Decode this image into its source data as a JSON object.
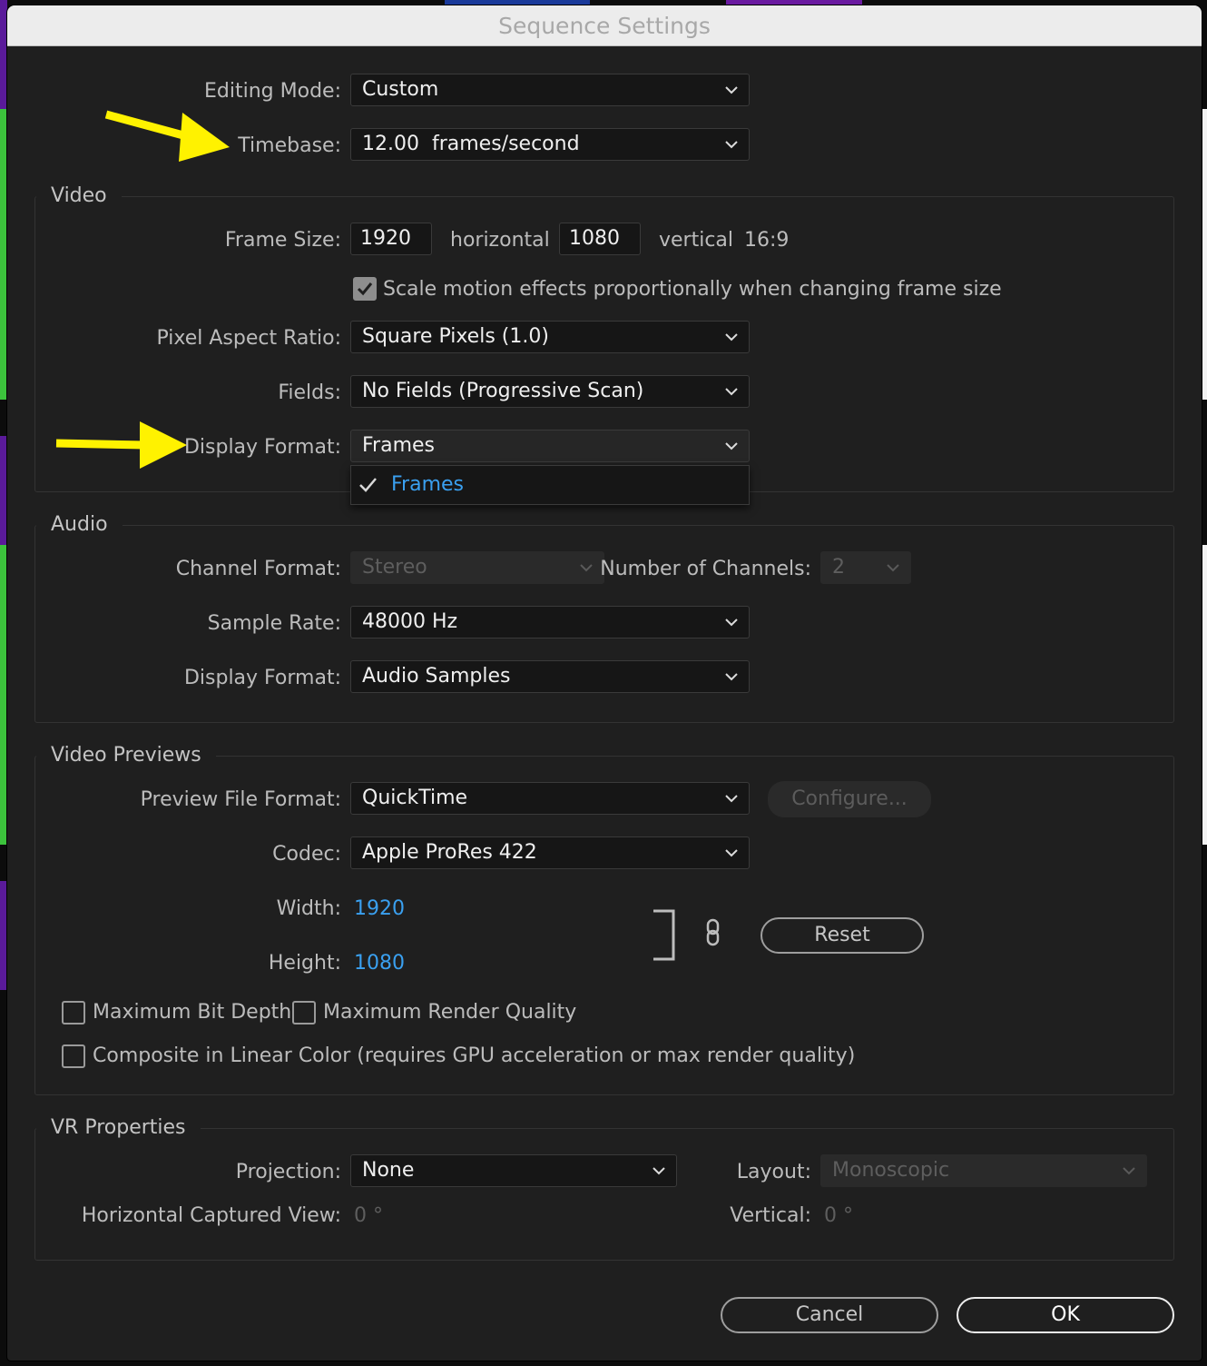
{
  "window": {
    "title": "Sequence Settings"
  },
  "general": {
    "editing_mode": {
      "label": "Editing Mode:",
      "value": "Custom"
    },
    "timebase": {
      "label": "Timebase:",
      "value": "12.00  frames/second"
    }
  },
  "video": {
    "title": "Video",
    "frame_size": {
      "label": "Frame Size:",
      "horizontal": "1920",
      "horizontal_label": "horizontal",
      "vertical": "1080",
      "vertical_label": "vertical",
      "aspect": "16:9"
    },
    "scale_motion": {
      "label": "Scale motion effects proportionally when changing frame size",
      "checked": true
    },
    "pixel_aspect": {
      "label": "Pixel Aspect Ratio:",
      "value": "Square Pixels (1.0)"
    },
    "fields": {
      "label": "Fields:",
      "value": "No Fields (Progressive Scan)"
    },
    "display_format": {
      "label": "Display Format:",
      "value": "Frames",
      "menu_options": [
        "Frames"
      ],
      "menu_selected": "Frames"
    }
  },
  "audio": {
    "title": "Audio",
    "channel_format": {
      "label": "Channel Format:",
      "value": "Stereo"
    },
    "num_channels": {
      "label": "Number of Channels:",
      "value": "2"
    },
    "sample_rate": {
      "label": "Sample Rate:",
      "value": "48000 Hz"
    },
    "display_format": {
      "label": "Display Format:",
      "value": "Audio Samples"
    }
  },
  "previews": {
    "title": "Video Previews",
    "file_format": {
      "label": "Preview File Format:",
      "value": "QuickTime"
    },
    "configure_button": "Configure...",
    "codec": {
      "label": "Codec:",
      "value": "Apple ProRes 422"
    },
    "width": {
      "label": "Width:",
      "value": "1920"
    },
    "height": {
      "label": "Height:",
      "value": "1080"
    },
    "reset_button": "Reset",
    "max_bit_depth": {
      "label": "Maximum Bit Depth",
      "checked": false
    },
    "max_render_quality": {
      "label": "Maximum Render Quality",
      "checked": false
    },
    "composite_linear": {
      "label": "Composite in Linear Color (requires GPU acceleration or max render quality)",
      "checked": false
    }
  },
  "vr": {
    "title": "VR Properties",
    "projection": {
      "label": "Projection:",
      "value": "None"
    },
    "layout": {
      "label": "Layout:",
      "value": "Monoscopic"
    },
    "h_captured_view": {
      "label": "Horizontal Captured View:",
      "value": "0 °"
    },
    "vertical": {
      "label": "Vertical:",
      "value": "0 °"
    }
  },
  "buttons": {
    "cancel": "Cancel",
    "ok": "OK"
  },
  "annotations": {
    "arrow_color": "#fff200"
  },
  "colors": {
    "accent_blue": "#3aa0f0",
    "dialog_bg": "#1f1f1f"
  }
}
